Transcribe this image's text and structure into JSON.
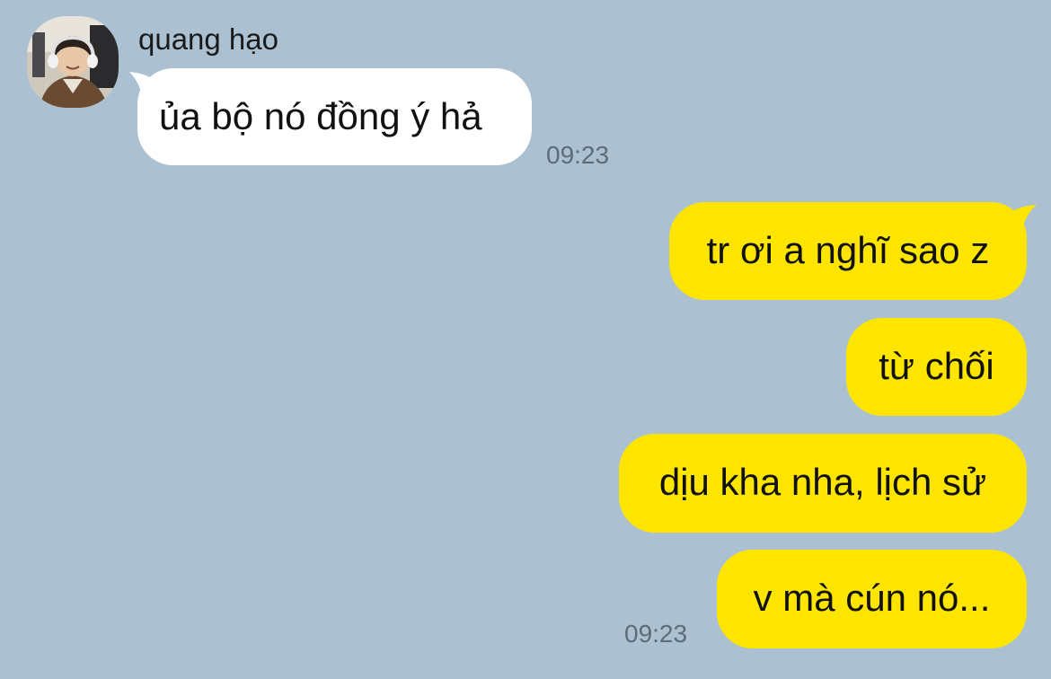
{
  "colors": {
    "background": "#abc1d1",
    "incoming_bubble": "#ffffff",
    "outgoing_bubble": "#fee500",
    "timestamp": "#5d6c78"
  },
  "incoming": {
    "sender_name": "quang hạo",
    "avatar": "profile-photo",
    "messages": [
      {
        "text": "ủa bộ nó đồng ý hả"
      }
    ],
    "time": "09:23"
  },
  "outgoing": {
    "messages": [
      {
        "text": "tr ơi a nghĩ sao z"
      },
      {
        "text": "từ chối"
      },
      {
        "text": "dịu kha nha, lịch sử"
      },
      {
        "text": "v mà cún nó..."
      }
    ],
    "time": "09:23"
  }
}
